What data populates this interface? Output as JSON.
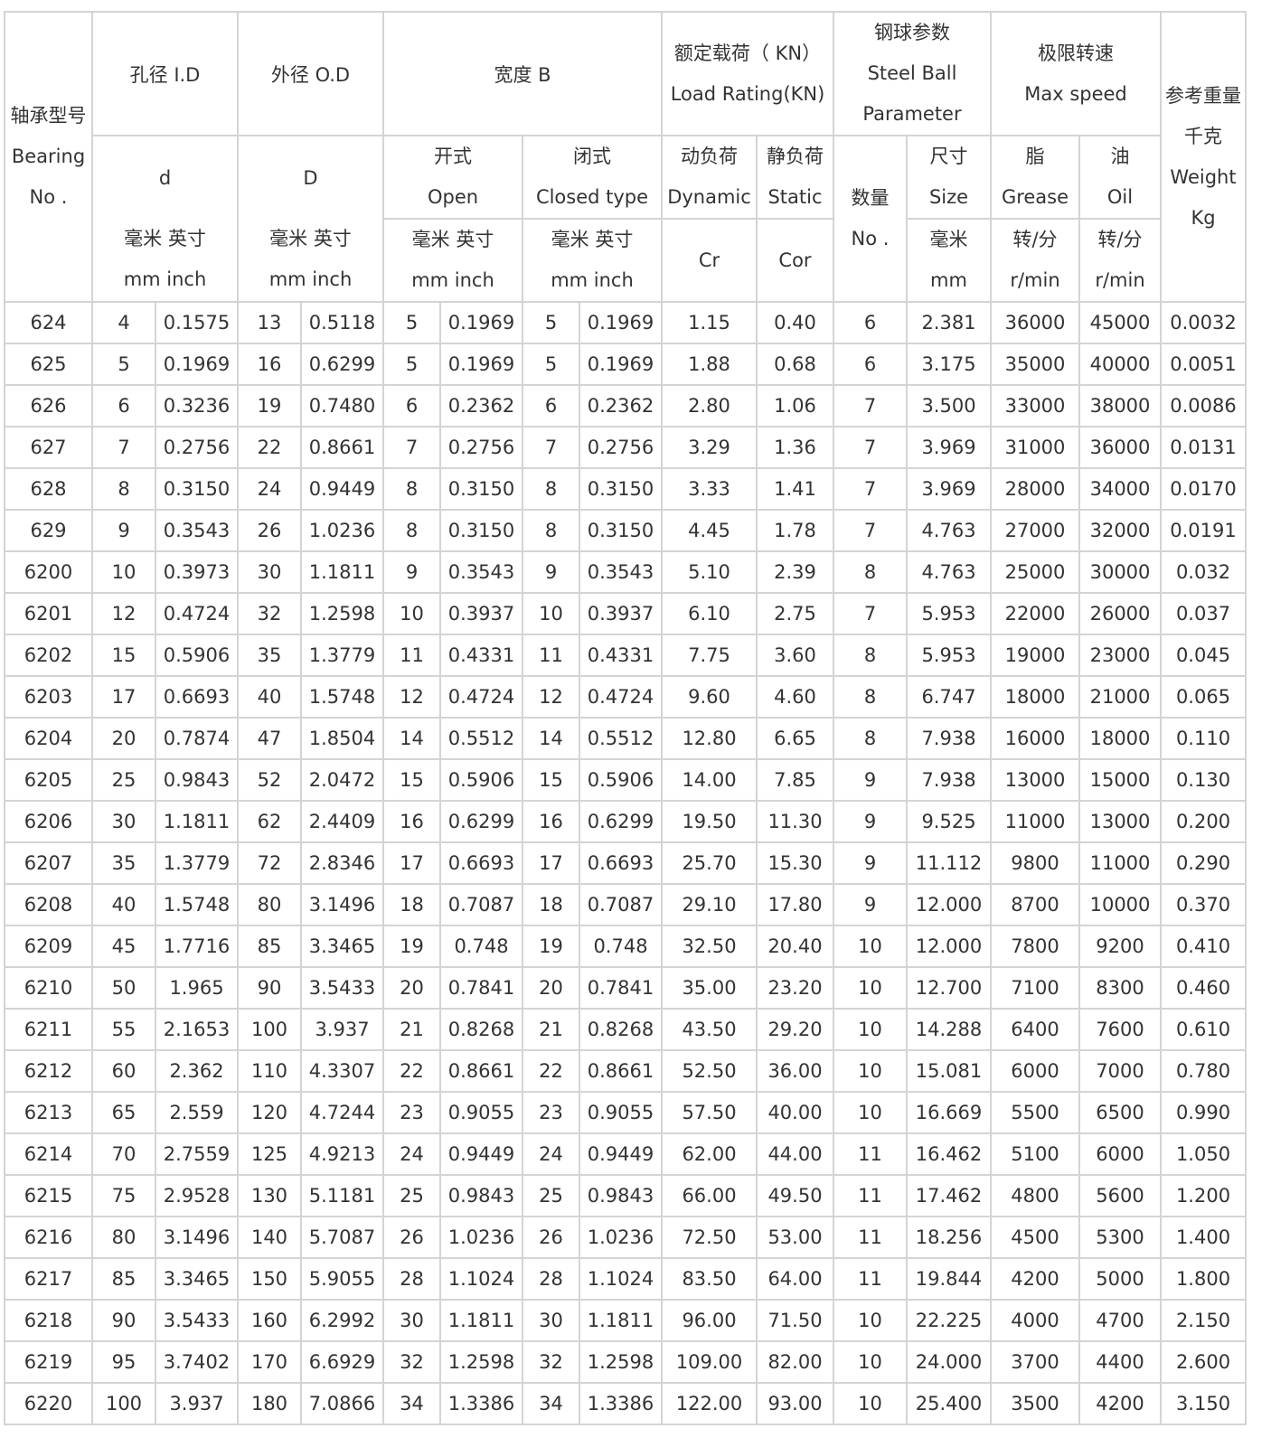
{
  "header": {
    "bearing_no": [
      "轴承型号",
      "Bearing",
      "No ."
    ],
    "bore_id": "孔径 I.D",
    "outer_od": "外径 O.D",
    "width_b": "宽度 B",
    "load_rating": [
      "额定载荷（ KN）",
      "Load Rating(KN)"
    ],
    "steel_ball": [
      "钢球参数",
      "Steel Ball",
      "Parameter"
    ],
    "max_speed": [
      "极限转速",
      "Max speed"
    ],
    "weight": [
      "参考重量",
      "千克",
      "Weight",
      "Kg"
    ],
    "d": "d",
    "D": "D",
    "open": [
      "开式",
      "Open"
    ],
    "closed": [
      "闭式",
      "Closed type"
    ],
    "dynamic": [
      "动负荷",
      "Dynamic"
    ],
    "static": [
      "静负荷",
      "Static"
    ],
    "ball_no": [
      "数量",
      "No ."
    ],
    "ball_size": [
      "尺寸",
      "Size"
    ],
    "grease": [
      "脂",
      "Grease"
    ],
    "oil": [
      "油",
      "Oil"
    ],
    "mm_inch_cn": "毫米 英寸",
    "mm_inch_en": "mm inch",
    "cr": "Cr",
    "cor": "Cor",
    "mm_cn": "毫米",
    "mm_en": "mm",
    "rpm_cn": "转/分",
    "rpm_en": "r/min"
  },
  "rows": [
    [
      "624",
      "4",
      "0.1575",
      "13",
      "0.5118",
      "5",
      "0.1969",
      "5",
      "0.1969",
      "1.15",
      "0.40",
      "6",
      "2.381",
      "36000",
      "45000",
      "0.0032"
    ],
    [
      "625",
      "5",
      "0.1969",
      "16",
      "0.6299",
      "5",
      "0.1969",
      "5",
      "0.1969",
      "1.88",
      "0.68",
      "6",
      "3.175",
      "35000",
      "40000",
      "0.0051"
    ],
    [
      "626",
      "6",
      "0.3236",
      "19",
      "0.7480",
      "6",
      "0.2362",
      "6",
      "0.2362",
      "2.80",
      "1.06",
      "7",
      "3.500",
      "33000",
      "38000",
      "0.0086"
    ],
    [
      "627",
      "7",
      "0.2756",
      "22",
      "0.8661",
      "7",
      "0.2756",
      "7",
      "0.2756",
      "3.29",
      "1.36",
      "7",
      "3.969",
      "31000",
      "36000",
      "0.0131"
    ],
    [
      "628",
      "8",
      "0.3150",
      "24",
      "0.9449",
      "8",
      "0.3150",
      "8",
      "0.3150",
      "3.33",
      "1.41",
      "7",
      "3.969",
      "28000",
      "34000",
      "0.0170"
    ],
    [
      "629",
      "9",
      "0.3543",
      "26",
      "1.0236",
      "8",
      "0.3150",
      "8",
      "0.3150",
      "4.45",
      "1.78",
      "7",
      "4.763",
      "27000",
      "32000",
      "0.0191"
    ],
    [
      "6200",
      "10",
      "0.3973",
      "30",
      "1.1811",
      "9",
      "0.3543",
      "9",
      "0.3543",
      "5.10",
      "2.39",
      "8",
      "4.763",
      "25000",
      "30000",
      "0.032"
    ],
    [
      "6201",
      "12",
      "0.4724",
      "32",
      "1.2598",
      "10",
      "0.3937",
      "10",
      "0.3937",
      "6.10",
      "2.75",
      "7",
      "5.953",
      "22000",
      "26000",
      "0.037"
    ],
    [
      "6202",
      "15",
      "0.5906",
      "35",
      "1.3779",
      "11",
      "0.4331",
      "11",
      "0.4331",
      "7.75",
      "3.60",
      "8",
      "5.953",
      "19000",
      "23000",
      "0.045"
    ],
    [
      "6203",
      "17",
      "0.6693",
      "40",
      "1.5748",
      "12",
      "0.4724",
      "12",
      "0.4724",
      "9.60",
      "4.60",
      "8",
      "6.747",
      "18000",
      "21000",
      "0.065"
    ],
    [
      "6204",
      "20",
      "0.7874",
      "47",
      "1.8504",
      "14",
      "0.5512",
      "14",
      "0.5512",
      "12.80",
      "6.65",
      "8",
      "7.938",
      "16000",
      "18000",
      "0.110"
    ],
    [
      "6205",
      "25",
      "0.9843",
      "52",
      "2.0472",
      "15",
      "0.5906",
      "15",
      "0.5906",
      "14.00",
      "7.85",
      "9",
      "7.938",
      "13000",
      "15000",
      "0.130"
    ],
    [
      "6206",
      "30",
      "1.1811",
      "62",
      "2.4409",
      "16",
      "0.6299",
      "16",
      "0.6299",
      "19.50",
      "11.30",
      "9",
      "9.525",
      "11000",
      "13000",
      "0.200"
    ],
    [
      "6207",
      "35",
      "1.3779",
      "72",
      "2.8346",
      "17",
      "0.6693",
      "17",
      "0.6693",
      "25.70",
      "15.30",
      "9",
      "11.112",
      "9800",
      "11000",
      "0.290"
    ],
    [
      "6208",
      "40",
      "1.5748",
      "80",
      "3.1496",
      "18",
      "0.7087",
      "18",
      "0.7087",
      "29.10",
      "17.80",
      "9",
      "12.000",
      "8700",
      "10000",
      "0.370"
    ],
    [
      "6209",
      "45",
      "1.7716",
      "85",
      "3.3465",
      "19",
      "0.748",
      "19",
      "0.748",
      "32.50",
      "20.40",
      "10",
      "12.000",
      "7800",
      "9200",
      "0.410"
    ],
    [
      "6210",
      "50",
      "1.965",
      "90",
      "3.5433",
      "20",
      "0.7841",
      "20",
      "0.7841",
      "35.00",
      "23.20",
      "10",
      "12.700",
      "7100",
      "8300",
      "0.460"
    ],
    [
      "6211",
      "55",
      "2.1653",
      "100",
      "3.937",
      "21",
      "0.8268",
      "21",
      "0.8268",
      "43.50",
      "29.20",
      "10",
      "14.288",
      "6400",
      "7600",
      "0.610"
    ],
    [
      "6212",
      "60",
      "2.362",
      "110",
      "4.3307",
      "22",
      "0.8661",
      "22",
      "0.8661",
      "52.50",
      "36.00",
      "10",
      "15.081",
      "6000",
      "7000",
      "0.780"
    ],
    [
      "6213",
      "65",
      "2.559",
      "120",
      "4.7244",
      "23",
      "0.9055",
      "23",
      "0.9055",
      "57.50",
      "40.00",
      "10",
      "16.669",
      "5500",
      "6500",
      "0.990"
    ],
    [
      "6214",
      "70",
      "2.7559",
      "125",
      "4.9213",
      "24",
      "0.9449",
      "24",
      "0.9449",
      "62.00",
      "44.00",
      "11",
      "16.462",
      "5100",
      "6000",
      "1.050"
    ],
    [
      "6215",
      "75",
      "2.9528",
      "130",
      "5.1181",
      "25",
      "0.9843",
      "25",
      "0.9843",
      "66.00",
      "49.50",
      "11",
      "17.462",
      "4800",
      "5600",
      "1.200"
    ],
    [
      "6216",
      "80",
      "3.1496",
      "140",
      "5.7087",
      "26",
      "1.0236",
      "26",
      "1.0236",
      "72.50",
      "53.00",
      "11",
      "18.256",
      "4500",
      "5300",
      "1.400"
    ],
    [
      "6217",
      "85",
      "3.3465",
      "150",
      "5.9055",
      "28",
      "1.1024",
      "28",
      "1.1024",
      "83.50",
      "64.00",
      "11",
      "19.844",
      "4200",
      "5000",
      "1.800"
    ],
    [
      "6218",
      "90",
      "3.5433",
      "160",
      "6.2992",
      "30",
      "1.1811",
      "30",
      "1.1811",
      "96.00",
      "71.50",
      "10",
      "22.225",
      "4000",
      "4700",
      "2.150"
    ],
    [
      "6219",
      "95",
      "3.7402",
      "170",
      "6.6929",
      "32",
      "1.2598",
      "32",
      "1.2598",
      "109.00",
      "82.00",
      "10",
      "24.000",
      "3700",
      "4400",
      "2.600"
    ],
    [
      "6220",
      "100",
      "3.937",
      "180",
      "7.0866",
      "34",
      "1.3386",
      "34",
      "1.3386",
      "122.00",
      "93.00",
      "10",
      "25.400",
      "3500",
      "4200",
      "3.150"
    ]
  ]
}
